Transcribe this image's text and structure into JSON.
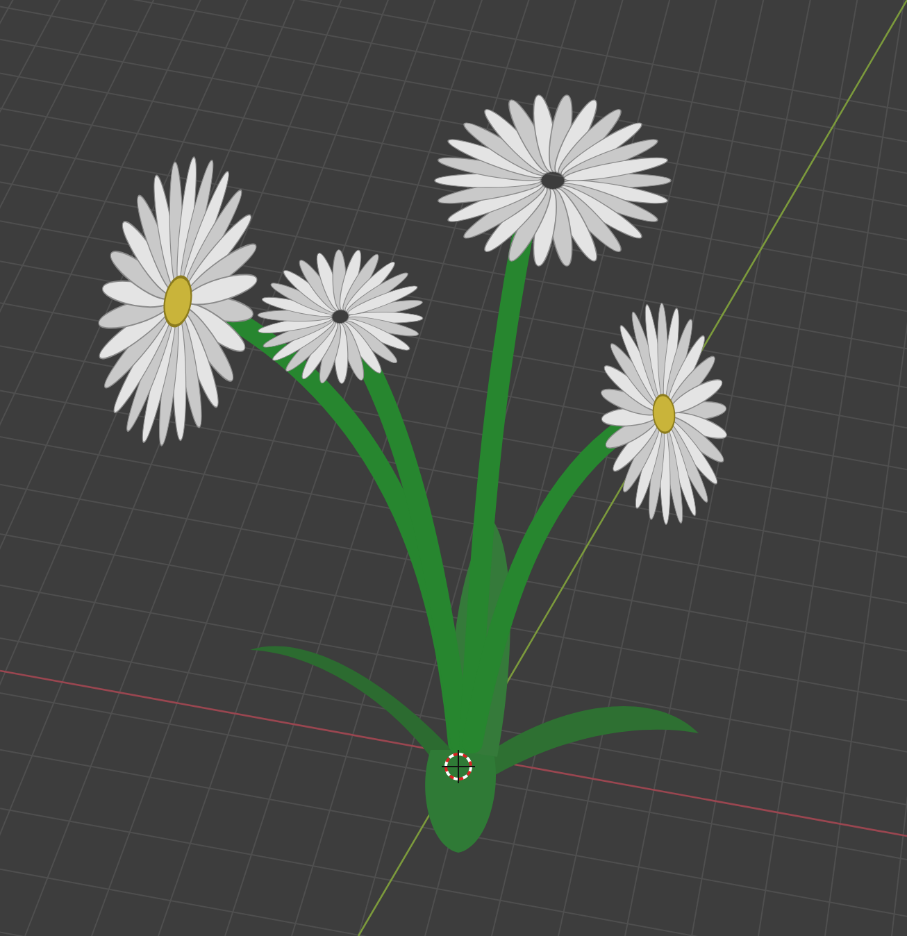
{
  "viewport": {
    "show_floor_grid": true,
    "show_axes": true,
    "show_cursor": true
  }
}
